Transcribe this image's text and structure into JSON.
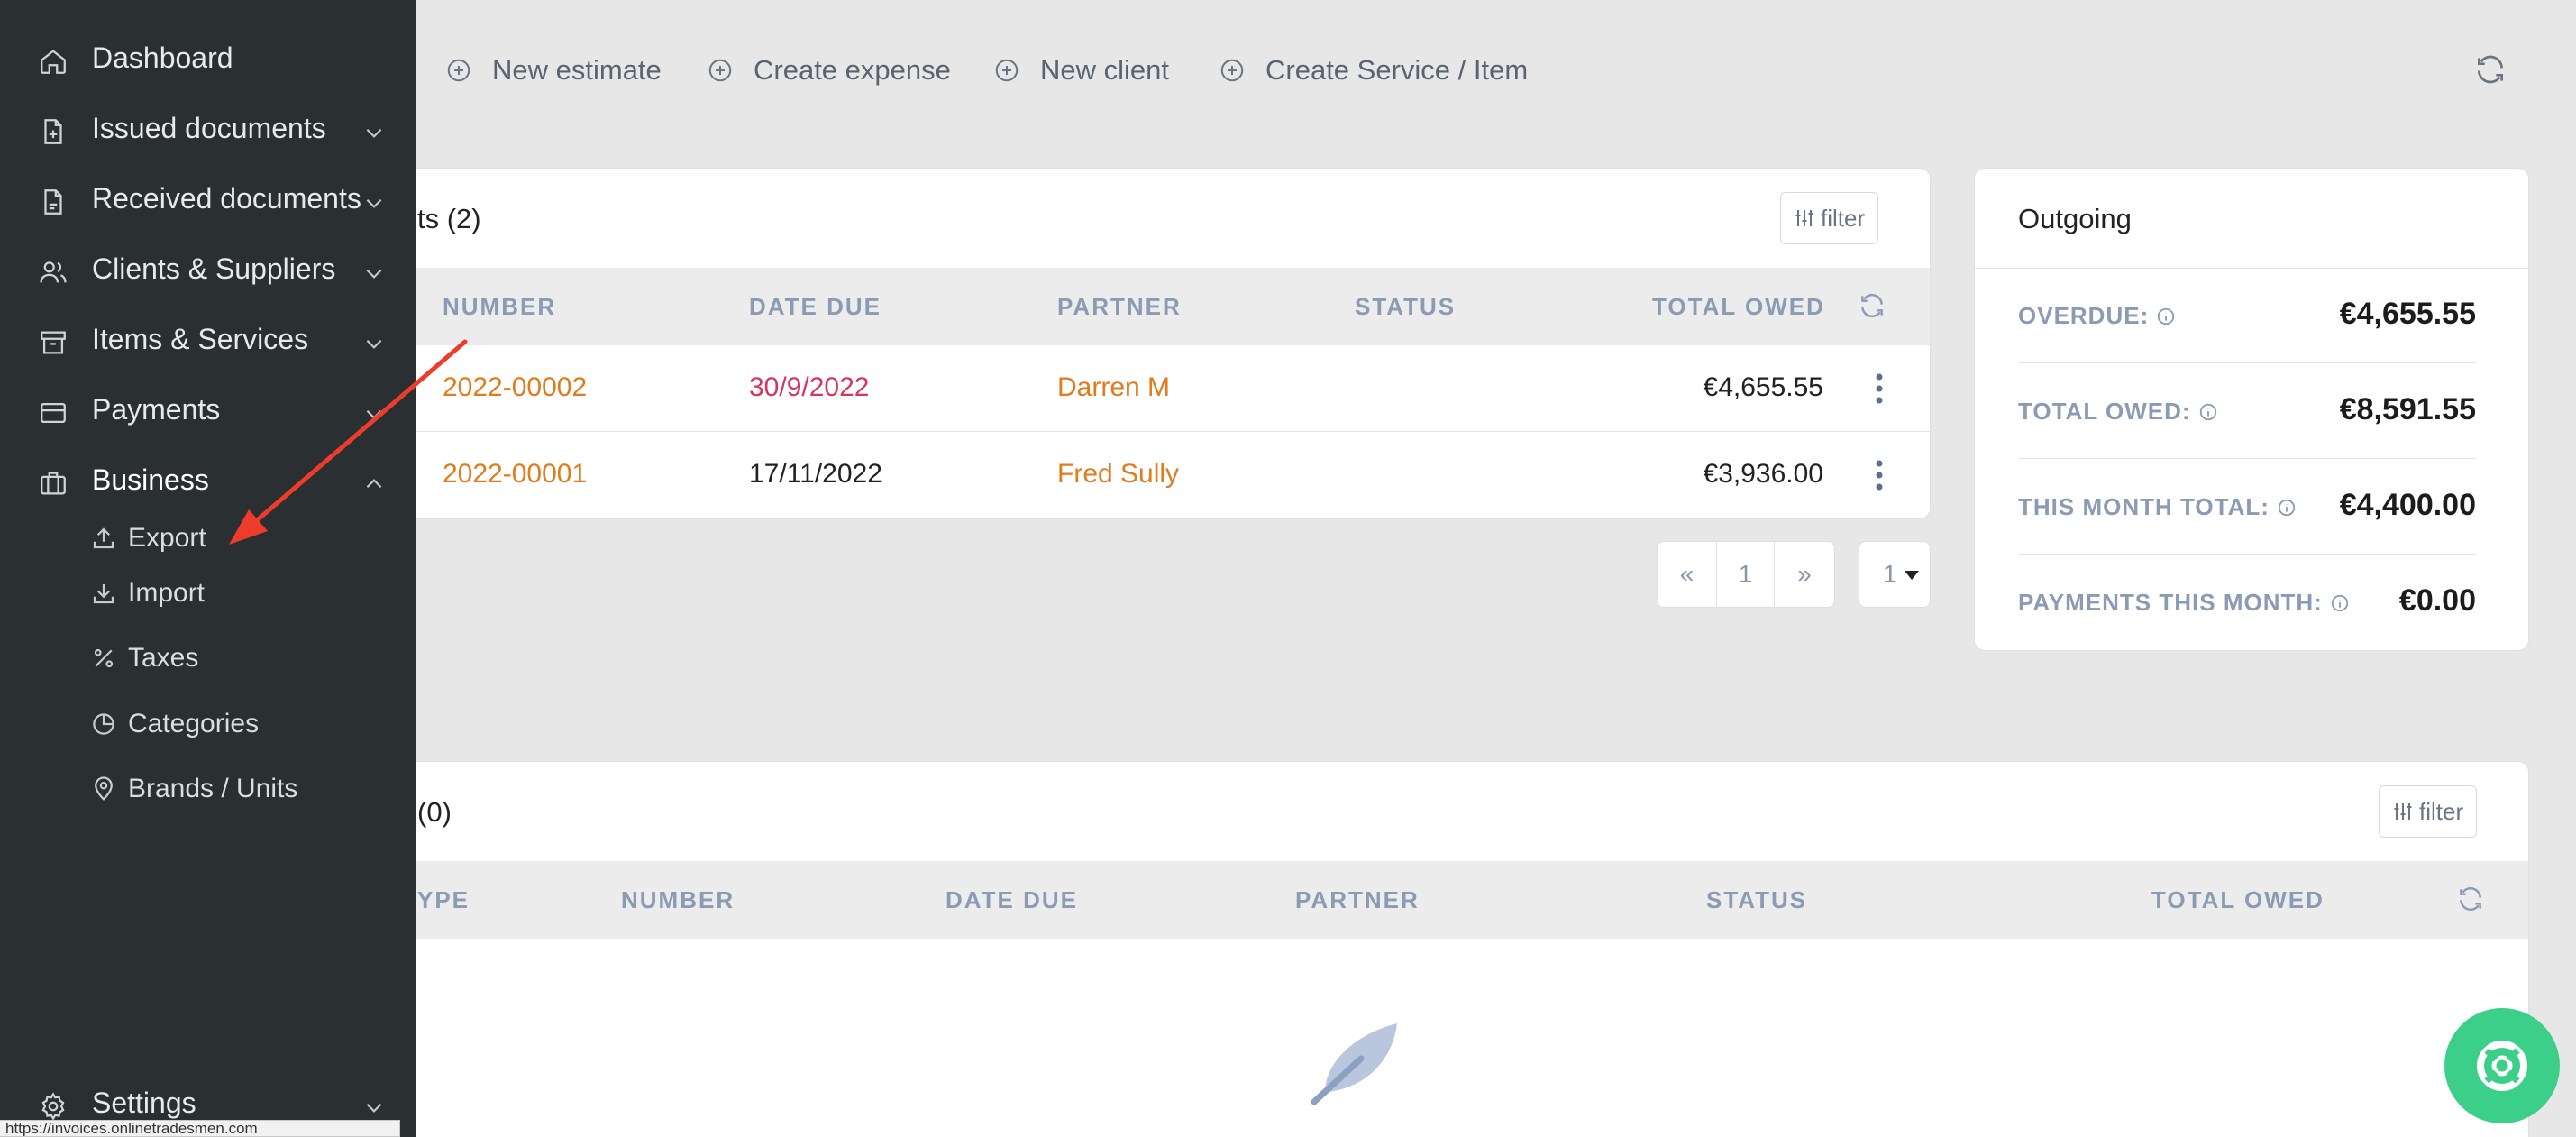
{
  "sidebar": {
    "items": [
      {
        "label": "Dashboard",
        "icon": "home-icon"
      },
      {
        "label": "Issued documents",
        "icon": "document-plus-icon"
      },
      {
        "label": "Received documents",
        "icon": "document-icon"
      },
      {
        "label": "Clients & Suppliers",
        "icon": "users-icon"
      },
      {
        "label": "Items & Services",
        "icon": "archive-icon"
      },
      {
        "label": "Payments",
        "icon": "credit-card-icon"
      },
      {
        "label": "Business",
        "icon": "briefcase-icon"
      }
    ],
    "business_sub": [
      {
        "label": "Export",
        "icon": "upload-icon"
      },
      {
        "label": "Import",
        "icon": "download-icon"
      },
      {
        "label": "Taxes",
        "icon": "percent-icon"
      },
      {
        "label": "Categories",
        "icon": "pie-chart-icon"
      },
      {
        "label": "Brands / Units",
        "icon": "map-pin-icon"
      }
    ],
    "settings": {
      "label": "Settings",
      "icon": "gear-icon"
    }
  },
  "status_url": "https://invoices.onlinetradesmen.com",
  "actions": [
    {
      "label": "New estimate"
    },
    {
      "label": "Create expense"
    },
    {
      "label": "New client"
    },
    {
      "label": "Create Service / Item"
    }
  ],
  "issued_card": {
    "title": "ts (2)",
    "filter_label": "filter",
    "columns": [
      "NUMBER",
      "DATE DUE",
      "PARTNER",
      "STATUS",
      "TOTAL OWED"
    ],
    "rows": [
      {
        "number": "2022-00002",
        "date_due": "30/9/2022",
        "partner": "Darren M",
        "status": "",
        "total": "€4,655.55",
        "overdue": true
      },
      {
        "number": "2022-00001",
        "date_due": "17/11/2022",
        "partner": "Fred Sully",
        "status": "",
        "total": "€3,936.00",
        "overdue": false
      }
    ],
    "pagination": {
      "prev": "«",
      "page": "1",
      "next": "»",
      "per_page": "1"
    }
  },
  "outgoing": {
    "title": "Outgoing",
    "rows": [
      {
        "label": "OVERDUE:",
        "value": "€4,655.55"
      },
      {
        "label": "TOTAL OWED:",
        "value": "€8,591.55"
      },
      {
        "label": "THIS MONTH TOTAL:",
        "value": "€4,400.00"
      },
      {
        "label": "PAYMENTS THIS MONTH:",
        "value": "€0.00"
      }
    ]
  },
  "received_card": {
    "title": "(0)",
    "filter_label": "filter",
    "columns": [
      "YPE",
      "NUMBER",
      "DATE DUE",
      "PARTNER",
      "STATUS",
      "TOTAL OWED"
    ]
  },
  "colors": {
    "sidebar_bg": "#2a3032",
    "accent_orange": "#e07b1e",
    "overdue_red": "#d6355c",
    "help_green": "#3ccf8a",
    "annotation_arrow": "#ee3b2b"
  }
}
